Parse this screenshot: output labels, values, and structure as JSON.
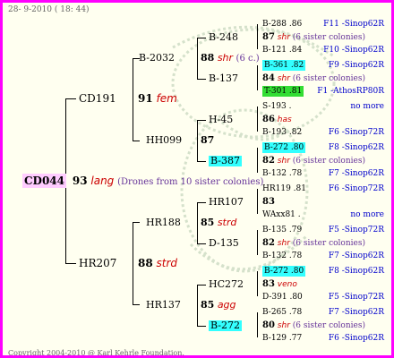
{
  "header": {
    "date": "28- 9-2010 ( 18: 44)"
  },
  "footer": {
    "copyright": "Copyright 2004-2010 @ Karl Kehrle Foundation."
  },
  "colors": {
    "border": "#ff00ff",
    "highlight": "#33ffff",
    "highlight_green": "#33dd33",
    "root_bg": "#ffccff"
  },
  "root": {
    "id": "CD044",
    "num": "93",
    "race": "lang",
    "note": "(Drones from 10 sister colonies)"
  },
  "g1": [
    {
      "id": "CD191",
      "num": "91",
      "race": "fem"
    },
    {
      "id": "HR207",
      "num": "88",
      "race": "strd"
    }
  ],
  "g2": [
    {
      "id": "B-2032",
      "num": "88",
      "race": "shr",
      "note": "(6 c.)"
    },
    {
      "id": "HH099",
      "num": "87",
      "race": ""
    },
    {
      "id": "HR188",
      "num": "85",
      "race": "strd"
    },
    {
      "id": "HR137",
      "num": "85",
      "race": "agg"
    }
  ],
  "g3": [
    "B-248",
    "B-137",
    "H-45",
    "B-387",
    "HR107",
    "D-135",
    "HC272",
    "B-272"
  ],
  "g4": [
    {
      "id": "B-288 .86",
      "src": "F11 -Sinop62R"
    },
    {
      "num": "87",
      "race": "shr",
      "note": "(6 sister colonies)"
    },
    {
      "id": "B-121 .84",
      "src": "F10 -Sinop62R"
    },
    {
      "id": "B-361 .82",
      "src": "F9 -Sinop62R"
    },
    {
      "num": "84",
      "race": "shr",
      "note": "(6 sister colonies)"
    },
    {
      "id": "T-301 .81",
      "src": "F1 -AthosRP80R"
    },
    {
      "id": "S-193 .",
      "src": "no more"
    },
    {
      "num": "86",
      "race": "has"
    },
    {
      "id": "B-193 .82",
      "src": "F6 -Sinop72R"
    },
    {
      "id": "B-272 .80",
      "src": "F8 -Sinop62R"
    },
    {
      "num": "82",
      "race": "shr",
      "note": "(6 sister colonies)"
    },
    {
      "id": "B-132 .78",
      "src": "F7 -Sinop62R"
    },
    {
      "id": "HR119 .81",
      "src": "F6 -Sinop72R"
    },
    {
      "num": "83"
    },
    {
      "id": "WAxx81 .",
      "src": "no more"
    },
    {
      "id": "B-135 .79",
      "src": "F5 -Sinop72R"
    },
    {
      "num": "82",
      "race": "shr",
      "note": "(6 sister colonies)"
    },
    {
      "id": "B-132 .78",
      "src": "F7 -Sinop62R"
    },
    {
      "id": "B-272 .80",
      "src": "F8 -Sinop62R"
    },
    {
      "num": "83",
      "race": "veno"
    },
    {
      "id": "D-391 .80",
      "src": "F5 -Sinop72R"
    },
    {
      "id": "B-265 .78",
      "src": "F7 -Sinop62R"
    },
    {
      "num": "80",
      "race": "shr",
      "note": "(6 sister colonies)"
    },
    {
      "id": "B-129 .77",
      "src": "F6 -Sinop62R"
    }
  ]
}
